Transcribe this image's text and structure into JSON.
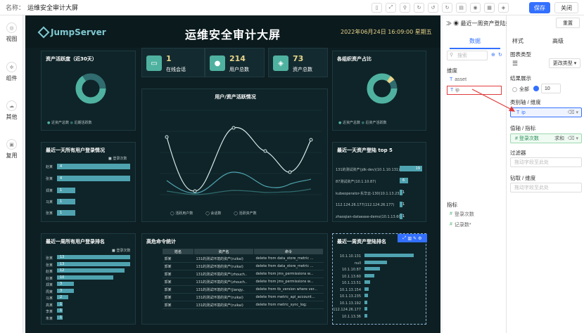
{
  "header": {
    "name_label": "名称：",
    "name_value": "运维安全审计大屏",
    "save": "保存",
    "close": "关闭"
  },
  "leftnav": [
    {
      "label": "视图",
      "icon": "view-icon"
    },
    {
      "label": "组件",
      "icon": "component-icon"
    },
    {
      "label": "其他",
      "icon": "other-icon"
    },
    {
      "label": "复用",
      "icon": "reuse-icon"
    }
  ],
  "dashboard": {
    "logo": "JumpServer",
    "title": "运维安全审计大屏",
    "time": "2022年06月24日 16:09:00 星期五",
    "stats": [
      {
        "value": "1",
        "label": "在线会话"
      },
      {
        "value": "214",
        "label": "用户总数"
      },
      {
        "value": "73",
        "label": "资产总数"
      }
    ],
    "asset_activity": {
      "title": "资产活跃度（近30天）",
      "legend": [
        "近资产总数",
        "近期活跃数"
      ]
    },
    "platform_ratio": {
      "title": "各组织资产占比",
      "legend": [
        "近资产总数",
        "近资产活跃数"
      ]
    },
    "user_login_day": {
      "title": "最近一天所有用户登录情况",
      "legend": "登录次数",
      "bars": [
        {
          "name": "赵某",
          "value": "4"
        },
        {
          "name": "张某",
          "value": "4"
        },
        {
          "name": "郑某",
          "value": "1"
        },
        {
          "name": "马某",
          "value": "1"
        },
        {
          "name": "张某",
          "value": "1"
        }
      ]
    },
    "line_chart": {
      "title": "用户/资产活跃情况",
      "legend": [
        "活跃用户数",
        "会话数",
        "活跃资产数"
      ]
    },
    "asset_top5": {
      "title": "最近一天资产登陆 top 5",
      "bars": [
        {
          "name": "131的测试资产(jdk-dev)(10.1.10.131)",
          "value": "19"
        },
        {
          "name": "87测试资产(10.1.10.87)",
          "value": "6"
        },
        {
          "name": "kubeoperator-东华云-130(10.1.13.235)",
          "value": "1"
        },
        {
          "name": "112.124.26.177(112.124.26.177)",
          "value": "1"
        },
        {
          "name": "zhaoqian-dataease-demo(10.1.13.60)",
          "value": "1"
        }
      ]
    },
    "user_login_week": {
      "title": "最近一周所有用户登录排名",
      "legend": "登录次数",
      "rows": [
        {
          "name": "张某",
          "value": "13"
        },
        {
          "name": "张某",
          "value": "13"
        },
        {
          "name": "赵某",
          "value": "12"
        },
        {
          "name": "赵某",
          "value": "10"
        },
        {
          "name": "郑某",
          "value": "3"
        },
        {
          "name": "周某",
          "value": "3"
        },
        {
          "name": "马某",
          "value": "2"
        },
        {
          "name": "高某",
          "value": "1"
        },
        {
          "name": "李某",
          "value": "1"
        },
        {
          "name": "朱某",
          "value": "1"
        }
      ]
    },
    "danger_cmd": {
      "title": "高危命令统计",
      "headers": [
        "姓名",
        "资产名",
        "命令"
      ],
      "rows": [
        [
          "郭某",
          "131的测试环境的资产(ruikai)",
          "delete from data_store_metric ..."
        ],
        [
          "郭某",
          "131的测试环境的资产(ruikai)",
          "delete from data_store_metric ..."
        ],
        [
          "郭某",
          "131的测试环境的资产(zhouch..",
          "delete from jms_permissions w..."
        ],
        [
          "郭某",
          "131的测试环境的资产(zhouch..",
          "delete from jms_permissions w..."
        ],
        [
          "郭某",
          "131的测试环境的资产(jiangy..",
          "delete from tb_version where ver..."
        ],
        [
          "郭某",
          "131的测试环境的资产(ruikai)",
          "delete from metric_api_account..."
        ],
        [
          "郭某",
          "131的测试环境的资产(ruikai)",
          "delete from metric_sync_log;"
        ]
      ]
    },
    "asset_week": {
      "title": "最近一周资产登陆排名",
      "rows": [
        "10.1.10.131",
        "null",
        "10.1.10.87",
        "10.1.13.60",
        "10.1.13.51",
        "10.1.13.154",
        "10.1.13.235",
        "10.1.13.192",
        "112.124.26.177",
        "10.1.13.36"
      ]
    }
  },
  "panel1": {
    "back_icon": "chevron-icon",
    "title": "最近一周资产登陆排名",
    "reset": "重置",
    "tab_data": "数据",
    "search_placeholder": "搜索",
    "dim_label": "维度",
    "dims": [
      "asset",
      "ip"
    ],
    "metric_label": "指标",
    "metrics": [
      "登录次数",
      "记录数*"
    ]
  },
  "panel2": {
    "tab_style": "样式",
    "tab_adv": "高级",
    "chart_type_label": "图表类型",
    "change_type": "更改类型",
    "result_label": "结果展示",
    "all": "全部",
    "count": "10",
    "category_label": "类别轴 / 维度",
    "category_value": "ip",
    "value_label": "值轴 / 指标",
    "value_value": "登录次数",
    "agg": "求和",
    "filter_label": "过滤器",
    "filter_ph": "拖动字段至此处",
    "drill_label": "钻取 / 维度",
    "drill_ph": "拖动字段至此处"
  }
}
